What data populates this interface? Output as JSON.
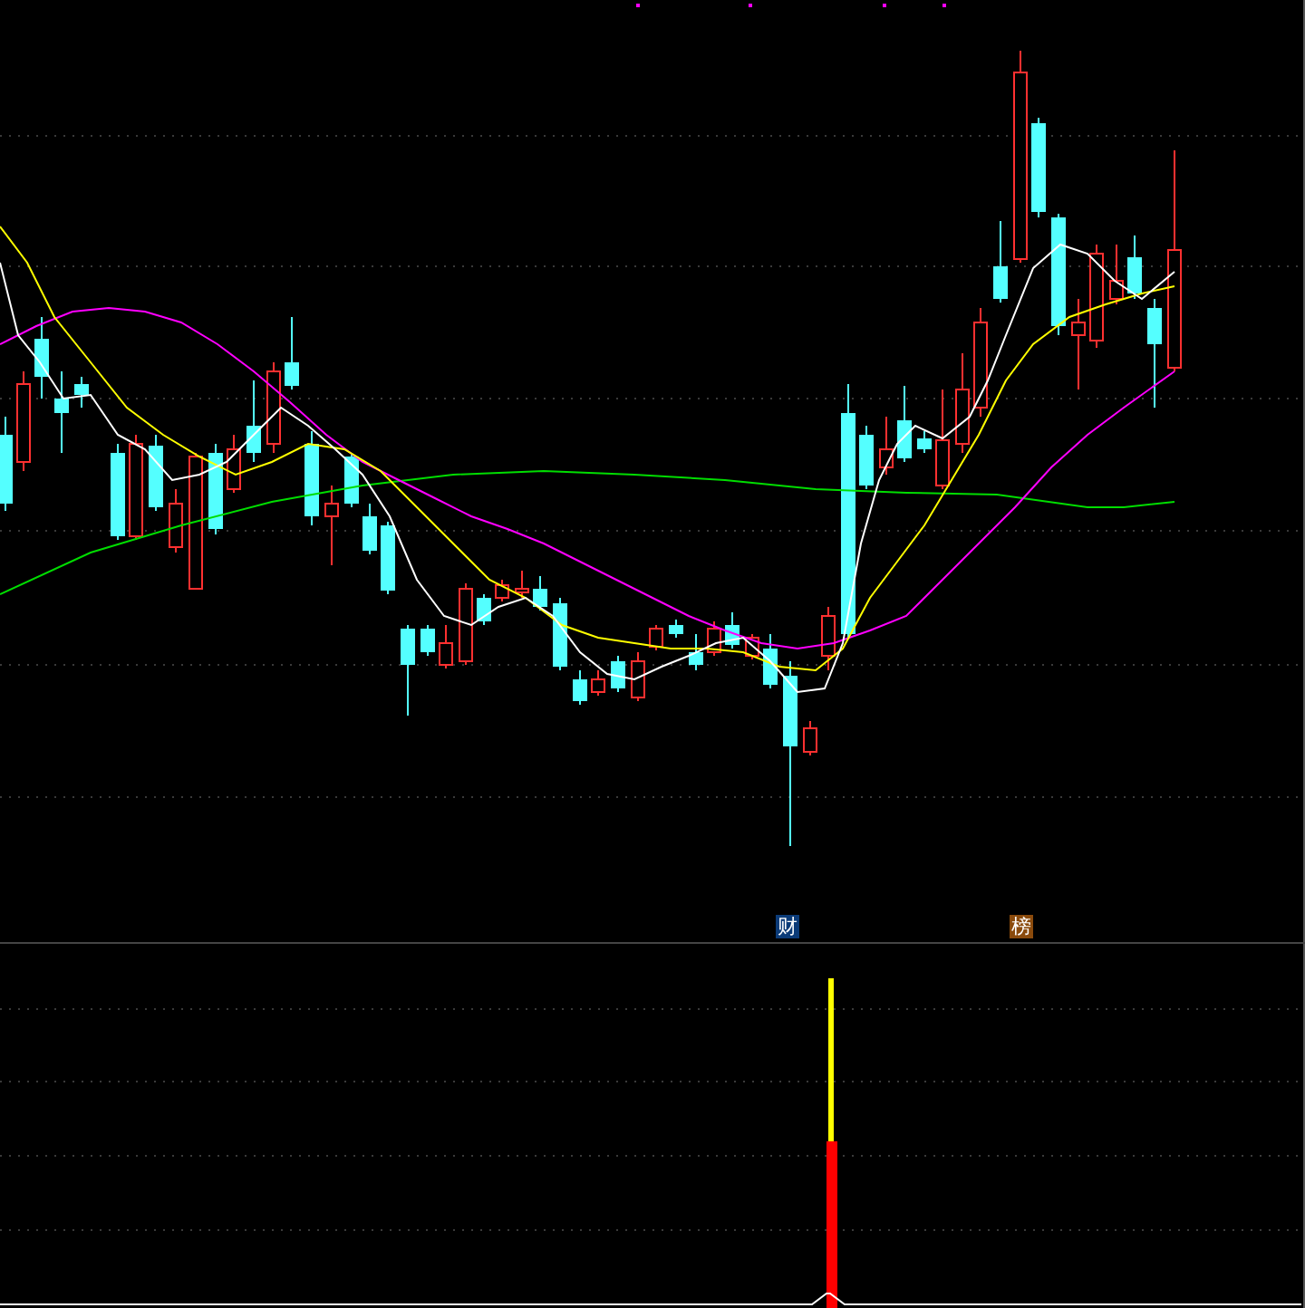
{
  "price_panel": {
    "markers": [
      {
        "label": "财",
        "color": "#0b3b78"
      },
      {
        "label": "榜",
        "color": "#8a4a0c"
      }
    ]
  }
}
